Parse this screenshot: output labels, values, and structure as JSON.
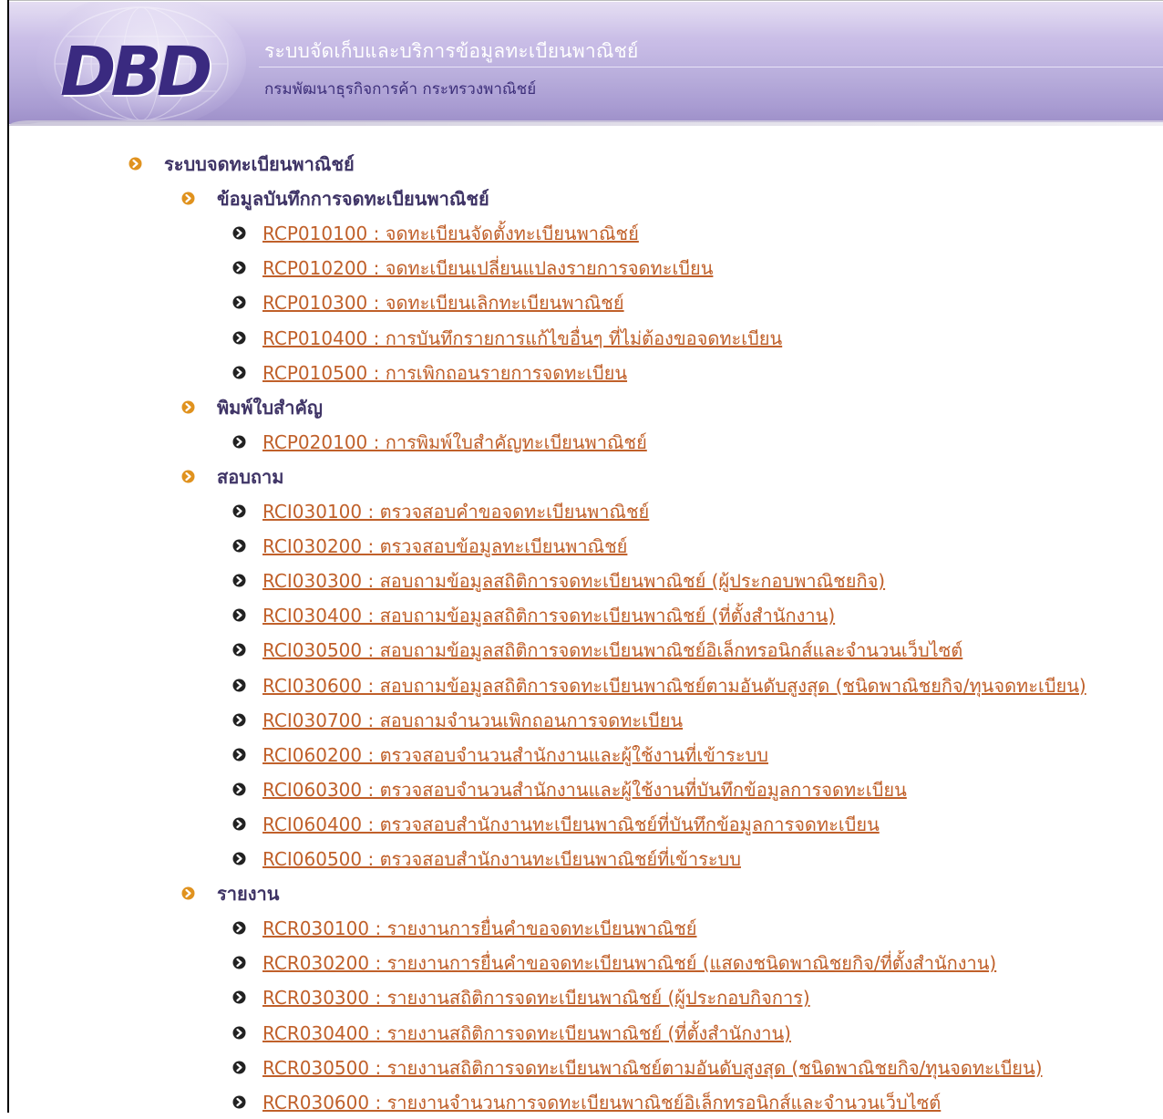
{
  "header": {
    "logo_text": "DBD",
    "title": "ระบบจัดเก็บและบริการข้อมูลทะเบียนพาณิชย์",
    "subtitle": "กรมพัฒนาธุรกิจการค้า  กระทรวงพาณิชย์"
  },
  "menu": {
    "root_label": "ระบบจดทะเบียนพาณิชย์",
    "sections": [
      {
        "label": "ข้อมูลบันทึกการจดทะเบียนพาณิชย์",
        "items": [
          "RCP010100 : จดทะเบียนจัดตั้งทะเบียนพาณิชย์",
          "RCP010200 : จดทะเบียนเปลี่ยนแปลงรายการจดทะเบียน",
          "RCP010300 : จดทะเบียนเลิกทะเบียนพาณิชย์",
          "RCP010400 : การบันทึกรายการแก้ไขอื่นๆ ที่ไม่ต้องขอจดทะเบียน",
          "RCP010500 : การเพิกถอนรายการจดทะเบียน"
        ]
      },
      {
        "label": "พิมพ์ใบสำคัญ",
        "items": [
          "RCP020100 : การพิมพ์ใบสำคัญทะเบียนพาณิชย์"
        ]
      },
      {
        "label": "สอบถาม",
        "items": [
          "RCI030100 : ตรวจสอบคำขอจดทะเบียนพาณิชย์",
          "RCI030200 : ตรวจสอบข้อมูลทะเบียนพาณิชย์",
          "RCI030300 : สอบถามข้อมูลสถิติการจดทะเบียนพาณิชย์ (ผู้ประกอบพาณิชยกิจ)",
          "RCI030400 : สอบถามข้อมูลสถิติการจดทะเบียนพาณิชย์ (ที่ตั้งสำนักงาน)",
          "RCI030500 : สอบถามข้อมูลสถิติการจดทะเบียนพาณิชย์อิเล็กทรอนิกส์และจำนวนเว็บไซต์",
          "RCI030600 : สอบถามข้อมูลสถิติการจดทะเบียนพาณิชย์ตามอันดับสูงสุด (ชนิดพาณิชยกิจ/ทุนจดทะเบียน)",
          "RCI030700 : สอบถามจำนวนเพิกถอนการจดทะเบียน",
          "RCI060200 : ตรวจสอบจำนวนสำนักงานและผู้ใช้งานที่เข้าระบบ",
          "RCI060300 : ตรวจสอบจำนวนสำนักงานและผู้ใช้งานที่บันทึกข้อมูลการจดทะเบียน",
          "RCI060400 : ตรวจสอบสำนักงานทะเบียนพาณิชย์ที่บันทึกข้อมูลการจดทะเบียน",
          "RCI060500 : ตรวจสอบสำนักงานทะเบียนพาณิชย์ที่เข้าระบบ"
        ]
      },
      {
        "label": "รายงาน",
        "items": [
          "RCR030100 : รายงานการยื่นคำขอจดทะเบียนพาณิชย์",
          "RCR030200 : รายงานการยื่นคำขอจดทะเบียนพาณิชย์ (แสดงชนิดพาณิชยกิจ/ที่ตั้งสำนักงาน)",
          "RCR030300 : รายงานสถิติการจดทะเบียนพาณิชย์ (ผู้ประกอบกิจการ)",
          "RCR030400 : รายงานสถิติการจดทะเบียนพาณิชย์ (ที่ตั้งสำนักงาน)",
          "RCR030500 : รายงานสถิติการจดทะเบียนพาณิชย์ตามอันดับสูงสุด (ชนิดพาณิชยกิจ/ทุนจดทะเบียน)",
          "RCR030600 : รายงานจำนวนการจดทะเบียนพาณิชย์อิเล็กทรอนิกส์และจำนวนเว็บไซต์"
        ]
      }
    ]
  },
  "colors": {
    "heading": "#3f3466",
    "link": "#c0602a",
    "bullet": "#e0921e"
  }
}
